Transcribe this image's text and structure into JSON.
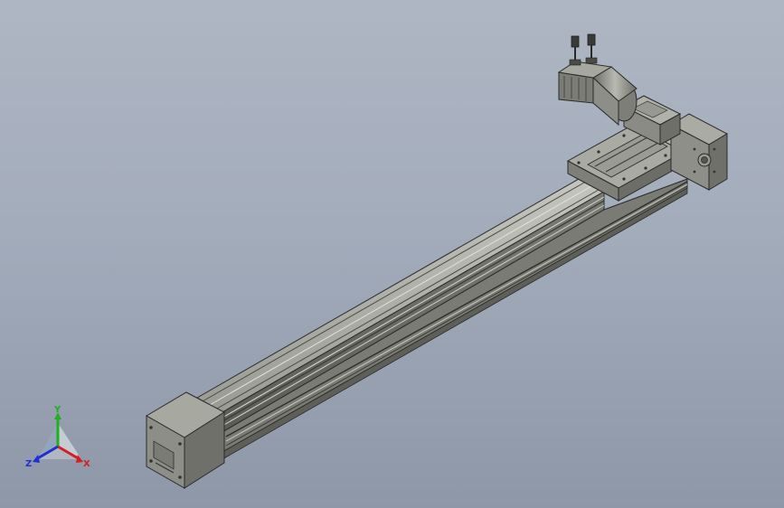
{
  "viewport": {
    "background_top": "#aeb6c3",
    "background_bottom": "#8e97a8"
  },
  "model": {
    "body_color": "#8c8d86",
    "edge_color": "#2a2a2a"
  },
  "triad": {
    "x_label": "X",
    "y_label": "Y",
    "z_label": "Z",
    "x_color": "#d42020",
    "y_color": "#20b020",
    "z_color": "#2030d0"
  }
}
